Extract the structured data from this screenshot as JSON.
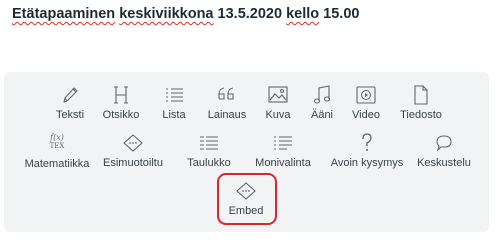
{
  "document": {
    "title_word1": "Etätapaaminen",
    "title_word2": "keskiviikkona",
    "title_word3": "13.5.2020",
    "title_word4": "kello",
    "title_word5": "15.00"
  },
  "toolbar": {
    "row1": [
      {
        "label": "Teksti",
        "icon": "pencil-icon"
      },
      {
        "label": "Otsikko",
        "icon": "heading-icon"
      },
      {
        "label": "Lista",
        "icon": "list-icon"
      },
      {
        "label": "Lainaus",
        "icon": "quote-icon"
      },
      {
        "label": "Kuva",
        "icon": "image-icon"
      },
      {
        "label": "Ääni",
        "icon": "music-note-icon"
      },
      {
        "label": "Video",
        "icon": "video-icon"
      },
      {
        "label": "Tiedosto",
        "icon": "file-icon"
      }
    ],
    "row2": [
      {
        "label": "Matematiikka",
        "icon": "math-formula-icon",
        "formula_top": "f(x)",
        "formula_bottom": "TEX"
      },
      {
        "label": "Esimuotoiltu",
        "icon": "code-diamond-icon"
      },
      {
        "label": "Taulukko",
        "icon": "table-icon"
      },
      {
        "label": "Monivalinta",
        "icon": "multiple-choice-icon"
      },
      {
        "label": "Avoin kysymys",
        "icon": "question-mark-icon"
      },
      {
        "label": "Keskustelu",
        "icon": "speech-bubble-icon"
      }
    ],
    "row3": [
      {
        "label": "Embed",
        "icon": "embed-icon"
      }
    ]
  },
  "colors": {
    "panel_bg": "#f1f3f4",
    "highlight": "#d9272e",
    "spellcheck": "#d8302a",
    "icon": "#5f686d",
    "label": "#3b4246"
  }
}
